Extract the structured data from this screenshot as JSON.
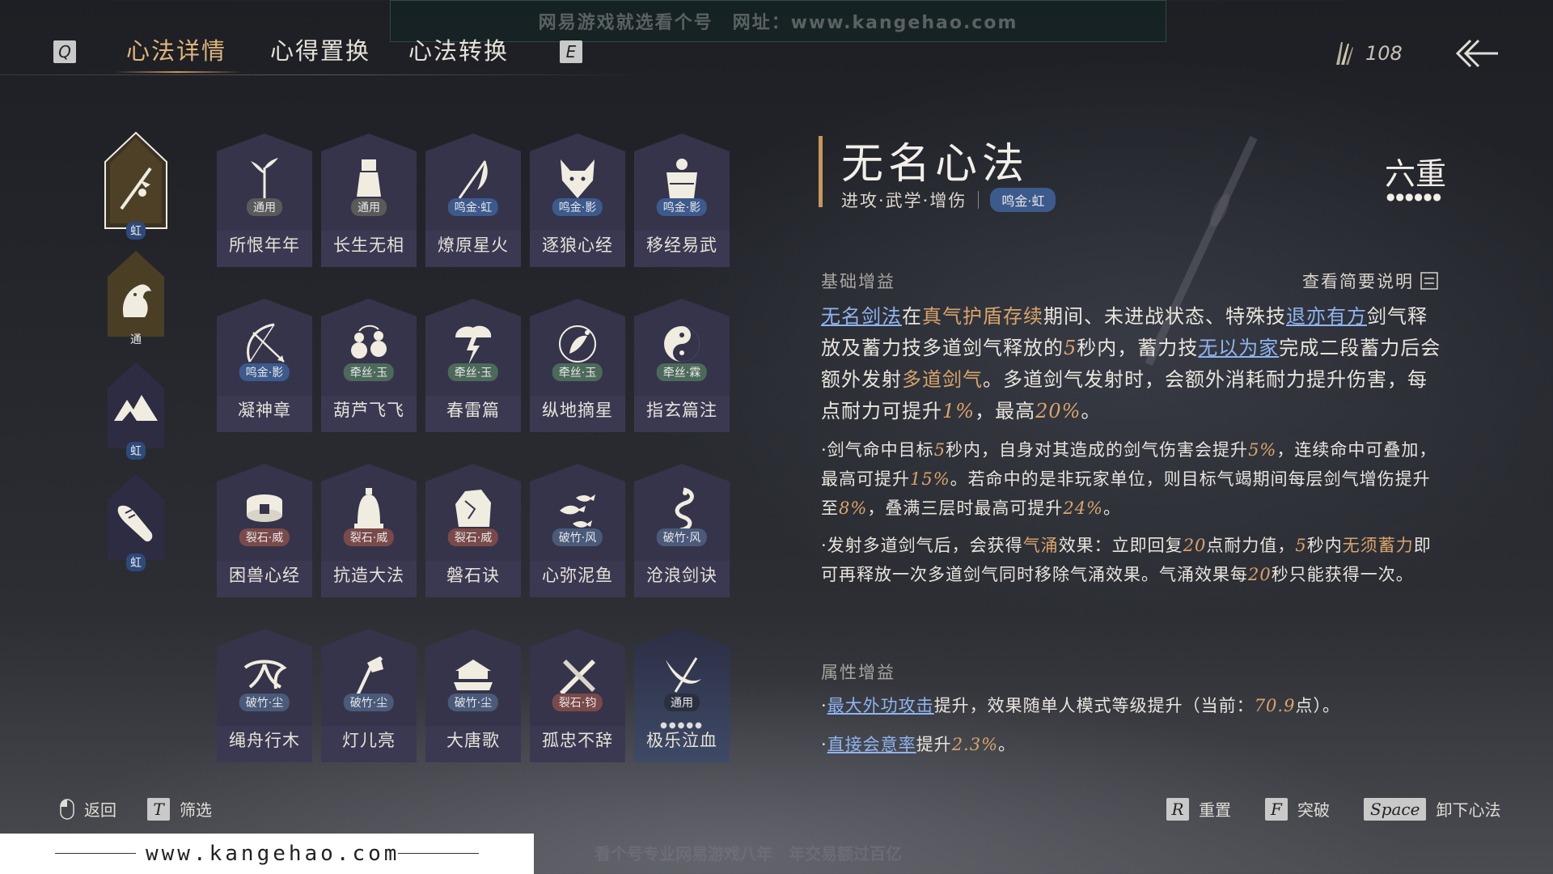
{
  "watermark_top": "网易游戏就选看个号　网址：www.kangehao.com",
  "topbar": {
    "key_left": "Q",
    "key_right": "E",
    "tabs": [
      "心法详情",
      "心得置换",
      "心法转换"
    ],
    "currency_value": "108",
    "back_icon": "back-arrow-icon"
  },
  "characters": [
    {
      "badge": "虹",
      "icon": "sword-icon",
      "selected": true
    },
    {
      "badge": "通",
      "icon": "horse-icon",
      "selected": false
    },
    {
      "badge": "虹",
      "icon": "mountain-icon",
      "selected": false
    },
    {
      "badge": "虹",
      "icon": "fist-icon",
      "selected": false
    }
  ],
  "cards": [
    {
      "name": "所恨年年",
      "tag": "通用",
      "tag_color": "#6a6a6a",
      "icon": "bamboo-icon"
    },
    {
      "name": "长生无相",
      "tag": "通用",
      "tag_color": "#6a6a6a",
      "icon": "statue-icon"
    },
    {
      "name": "燎原星火",
      "tag": "鸣金·虹",
      "tag_color": "#3c5a8c",
      "icon": "scythe-icon"
    },
    {
      "name": "逐狼心经",
      "tag": "鸣金·影",
      "tag_color": "#3c5a8c",
      "icon": "wolf-icon"
    },
    {
      "name": "移经易武",
      "tag": "鸣金·影",
      "tag_color": "#3c5a8c",
      "icon": "armor-icon"
    },
    {
      "name": "凝神章",
      "tag": "鸣金·影",
      "tag_color": "#3c5a8c",
      "icon": "bow-icon"
    },
    {
      "name": "葫芦飞飞",
      "tag": "牵丝·玉",
      "tag_color": "#4c6a5a",
      "icon": "gourd-icon"
    },
    {
      "name": "春雷篇",
      "tag": "牵丝·玉",
      "tag_color": "#4c6a5a",
      "icon": "thunder-icon"
    },
    {
      "name": "纵地摘星",
      "tag": "牵丝·玉",
      "tag_color": "#4c6a5a",
      "icon": "star-orbit-icon"
    },
    {
      "name": "指玄篇注",
      "tag": "牵丝·霖",
      "tag_color": "#4c6a5a",
      "icon": "yinyang-icon"
    },
    {
      "name": "困兽心经",
      "tag": "裂石·威",
      "tag_color": "#7a4a4a",
      "icon": "shackle-icon"
    },
    {
      "name": "抗造大法",
      "tag": "裂石·威",
      "tag_color": "#7a4a4a",
      "icon": "bell-icon"
    },
    {
      "name": "磐石诀",
      "tag": "裂石·威",
      "tag_color": "#7a4a4a",
      "icon": "rock-icon"
    },
    {
      "name": "心弥泥鱼",
      "tag": "破竹·风",
      "tag_color": "#4a5a7a",
      "icon": "fish-icon"
    },
    {
      "name": "沧浪剑诀",
      "tag": "破竹·风",
      "tag_color": "#4a5a7a",
      "icon": "dragon-icon"
    },
    {
      "name": "绳舟行木",
      "tag": "破竹·尘",
      "tag_color": "#4a5a7a",
      "icon": "roots-icon"
    },
    {
      "name": "灯儿亮",
      "tag": "破竹·尘",
      "tag_color": "#4a5a7a",
      "icon": "lamp-icon"
    },
    {
      "name": "大唐歌",
      "tag": "破竹·尘",
      "tag_color": "#4a5a7a",
      "icon": "palace-icon"
    },
    {
      "name": "孤忠不辞",
      "tag": "裂石·钧",
      "tag_color": "#7a4a4a",
      "icon": "blades-icon"
    },
    {
      "name": "极乐泣血",
      "tag": "通用",
      "tag_color": "#2a3040",
      "icon": "slash-icon",
      "selected": true,
      "dots": "●●●●●"
    }
  ],
  "detail": {
    "title": "无名心法",
    "subtitle": "进攻·武学·增伤",
    "tag": "鸣金·虹",
    "rank": "六重",
    "rank_dots": "●●●●●●",
    "base_header": "基础增益",
    "help_link": "查看简要说明",
    "p1": {
      "a": "无名剑法",
      "b": "在",
      "c": "真气护盾存续",
      "d": "期间、未进战状态、特殊技",
      "e": "退亦有方",
      "f": "剑气释放及蓄力技多道剑气释放的",
      "g": "5",
      "h": "秒内，蓄力技",
      "i": "无以为家",
      "j": "完成二段蓄力后会额外发射",
      "k": "多道剑气",
      "l": "。多道剑气发射时，会额外消耗耐力提升伤害，每点耐力可提升",
      "m": "1%",
      "n": "，最高",
      "o": "20%",
      "p": "。"
    },
    "p2": {
      "a": "·剑气命中目标",
      "b": "5",
      "c": "秒内，自身对其造成的剑气伤害会提升",
      "d": "5%",
      "e": "，连续命中可叠加，最高可提升",
      "f": "15%",
      "g": "。若命中的是非玩家单位，则目标气竭期间每层剑气增伤提升至",
      "h": "8%",
      "i": "，叠满三层时最高可提升",
      "j": "24%",
      "k": "。"
    },
    "p3": {
      "a": "·发射多道剑气后，会获得",
      "b": "气涌",
      "c": "效果：立即回复",
      "d": "20",
      "e": "点耐力值，",
      "f": "5",
      "g": "秒内",
      "h": "无须蓄力",
      "i": "即可再释放一次多道剑气同时移除气涌效果。气涌效果每",
      "j": "20",
      "k": "秒只能获得一次。"
    },
    "attr_header": "属性增益",
    "attr1": {
      "a": "·",
      "b": "最大外功攻击",
      "c": "提升，效果随单人模式等级提升（当前：",
      "d": "70.9",
      "e": "点）。"
    },
    "attr2": {
      "a": "·",
      "b": "直接会意率",
      "c": "提升",
      "d": "2.3%",
      "e": "。"
    }
  },
  "bottombar": {
    "back": "返回",
    "filter_key": "T",
    "filter": "筛选",
    "reset_key": "R",
    "reset": "重置",
    "break_key": "F",
    "break": "突破",
    "unload_key": "Space",
    "unload": "卸下心法"
  },
  "footer": {
    "site": "www.kangehao.com",
    "slogan": "看个号专业网易游戏八年　年交易额过百亿"
  },
  "colors": {
    "accent": "#d9a46a",
    "link": "#8fb4f0",
    "card_bg": "#3a3850"
  }
}
